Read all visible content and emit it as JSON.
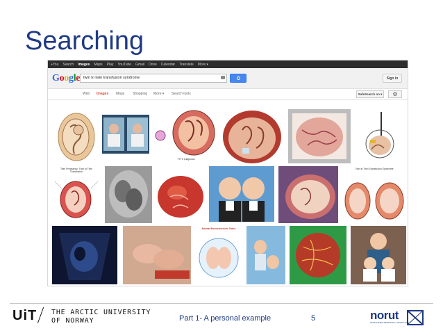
{
  "slide": {
    "title": "Searching",
    "footer_text": "Part 1- A personal example",
    "page_number": "5",
    "uit_logo": "UiT",
    "university_line1": "THE ARCTIC UNIVERSITY",
    "university_line2": "OF NORWAY",
    "norut_logo": "norut",
    "norut_tagline": "NORTHERN RESEARCH INSTITUTE"
  },
  "google_bar": [
    "+You",
    "Search",
    "Images",
    "Maps",
    "Play",
    "YouTube",
    "Gmail",
    "Drive",
    "Calendar",
    "Translate",
    "More ▾"
  ],
  "google_bar_active": "Images",
  "search": {
    "query": "twin to twin transfusion syndrome",
    "sign_in": "Sign in"
  },
  "tabs": [
    "Web",
    "Images",
    "Maps",
    "Shopping",
    "More ▾",
    "Search tools"
  ],
  "active_tab": "Images",
  "safesearch": "SafeSearch on ▾",
  "colors": {
    "accent": "#1f3a84",
    "google_blue": "#4787ed",
    "tab_active": "#dd4b39"
  },
  "results": [
    {
      "name": "fetus-diagram-1"
    },
    {
      "name": "twins-incubator-photo"
    },
    {
      "name": "ttts-illustration-diagram",
      "caption": "TTTS Diagnosis"
    },
    {
      "name": "placenta-twins-illustration"
    },
    {
      "name": "placenta-vessels-illustration"
    },
    {
      "name": "laser-surgery-illustration"
    },
    {
      "name": "two-pregnancy-diagram",
      "caption": "Twin Pregnancy: Twin to Twin Transfusion"
    },
    {
      "name": "ultrasound-grayscale"
    },
    {
      "name": "placenta-photo"
    },
    {
      "name": "twin-babies-photo"
    },
    {
      "name": "uterus-twins-illustration"
    },
    {
      "name": "ttts-comparison-chart",
      "caption": "Twin to Twin Transfusion Syndrome"
    },
    {
      "name": "ultrasound-dark"
    },
    {
      "name": "premature-twins-photo"
    },
    {
      "name": "monochorionic-twins-drawing",
      "caption": "Normal Monochorionic Twins"
    },
    {
      "name": "twin-infants-photo"
    },
    {
      "name": "placenta-injected-photo"
    },
    {
      "name": "mother-with-twins-photo"
    }
  ]
}
